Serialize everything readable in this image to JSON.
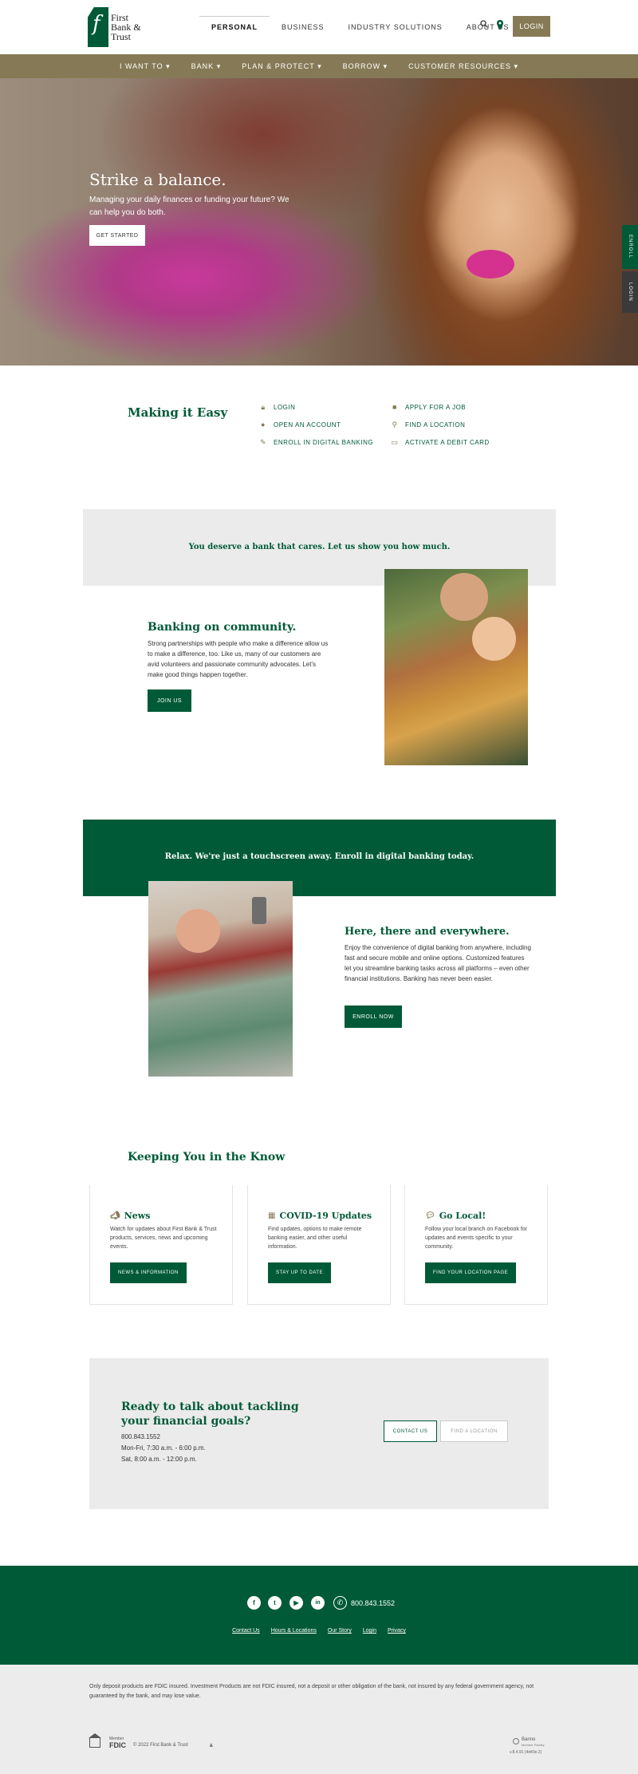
{
  "header": {
    "logo_text": [
      "First",
      "Bank &",
      "Trust"
    ],
    "logo_mark": "f",
    "nav": [
      "PERSONAL",
      "BUSINESS",
      "INDUSTRY SOLUTIONS",
      "ABOUT US"
    ],
    "login": "LOGIN"
  },
  "subnav": [
    "I WANT TO",
    "BANK",
    "PLAN & PROTECT",
    "BORROW",
    "CUSTOMER RESOURCES"
  ],
  "hero": {
    "title": "Strike a balance.",
    "subtitle": "Managing your daily finances or funding your future? We can help you do both.",
    "button": "GET STARTED"
  },
  "side_tabs": [
    "ENROLL",
    "LOGIN"
  ],
  "making_easy": {
    "title": "Making it Easy",
    "links": [
      {
        "label": "LOGIN",
        "icon": "lock-icon"
      },
      {
        "label": "APPLY FOR A JOB",
        "icon": "briefcase-icon"
      },
      {
        "label": "OPEN AN ACCOUNT",
        "icon": "piggy-bank-icon"
      },
      {
        "label": "FIND A LOCATION",
        "icon": "map-pin-icon"
      },
      {
        "label": "ENROLL IN DIGITAL BANKING",
        "icon": "edit-icon"
      },
      {
        "label": "ACTIVATE A DEBIT CARD",
        "icon": "card-icon"
      }
    ]
  },
  "community": {
    "banner": "You deserve a bank that cares. Let us show you how much.",
    "title": "Banking on community.",
    "body": "Strong partnerships with people who make a difference allow us to make a difference, too. Like us, many of our customers are avid volunteers and passionate community advocates. Let's make good things happen together.",
    "button": "JOIN US"
  },
  "digital": {
    "banner": "Relax. We're just a touchscreen away. Enroll in digital banking today.",
    "title": "Here, there and everywhere.",
    "body": "Enjoy the convenience of digital banking from anywhere, including fast and secure mobile and online options. Customized features let you streamline banking tasks across all platforms – even other financial institutions. Banking has never been easier.",
    "button": "ENROLL NOW"
  },
  "know": {
    "title": "Keeping You in the Know",
    "cards": [
      {
        "title": "News",
        "icon": "megaphone-icon",
        "body": "Watch for updates about First Bank & Trust products, services, news and upcoming events.",
        "button": "NEWS & INFORMATION"
      },
      {
        "title": "COVID-19 Updates",
        "icon": "calendar-icon",
        "body": "Find updates, options to make remote banking easier, and other useful information.",
        "button": "STAY UP TO DATE"
      },
      {
        "title": "Go Local!",
        "icon": "chat-icon",
        "body": "Follow your local branch on Facebook for updates and events specific to your community.",
        "button": "FIND YOUR LOCATION PAGE"
      }
    ]
  },
  "contact": {
    "title": "Ready to talk about tackling your financial goals?",
    "phone": "800.843.1552",
    "hours1": "Mon-Fri, 7:30 a.m. - 6:00 p.m.",
    "hours2": "Sat, 8:00 a.m. - 12:00 p.m.",
    "btn_contact": "CONTACT US",
    "btn_location": "FIND A LOCATION"
  },
  "footer": {
    "social": [
      "f",
      "t",
      "▶",
      "in"
    ],
    "phone": "800.843.1552",
    "links": [
      "Contact Us",
      "Hours & Locations",
      "Our Story",
      "Login",
      "Privacy"
    ]
  },
  "legal": {
    "disclaimer": "Only deposit products are FDIC insured. Investment Products are not FDIC insured, not a deposit or other obligation of the bank, not insured by any federal government agency, not guaranteed by the bank, and may lose value.",
    "fdic_small": "Member",
    "fdic": "FDIC",
    "copyright": "© 2022 First Bank & Trust",
    "banno": "Banno",
    "banno_sub": "Member Fidelity",
    "version": "v.8.4.91 (4d40e.2)"
  },
  "colors": {
    "brand_green": "#005a37",
    "gold": "#857a55",
    "gray_band": "#ebebeb"
  }
}
